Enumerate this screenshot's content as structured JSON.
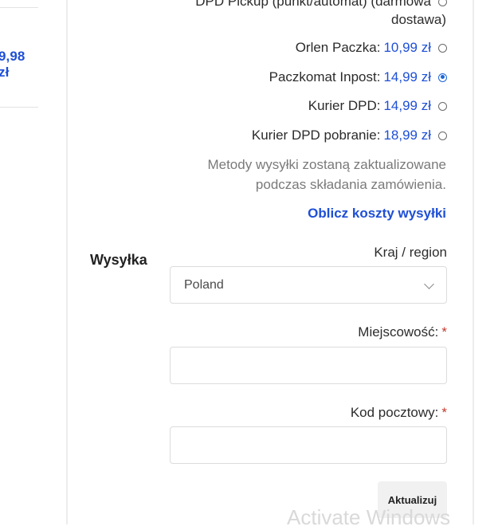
{
  "left": {
    "price": "9,98 zł"
  },
  "shipping": {
    "option_top": {
      "label": "DPD Pickup (punkt/automat) (darmowa",
      "label_cont": "dostawa)"
    },
    "options": [
      {
        "label": "Orlen Paczka:",
        "price": "10,99 zł",
        "checked": false
      },
      {
        "label": "Paczkomat Inpost:",
        "price": "14,99 zł",
        "checked": true
      },
      {
        "label": "Kurier DPD:",
        "price": "14,99 zł",
        "checked": false
      },
      {
        "label": "Kurier DPD pobranie:",
        "price": "18,99 zł",
        "checked": false
      }
    ],
    "note_line1": "Metody wysyłki zostaną zaktualizowane",
    "note_line2": "podczas składania zamówienia.",
    "calc_link": "Oblicz koszty wysyłki"
  },
  "form": {
    "section_label": "Wysyłka",
    "country_label": "Kraj / region",
    "country_value": "Poland",
    "city_label": "Miejscowość:",
    "postcode_label": "Kod pocztowy:",
    "required_mark": "*",
    "update_label": "Aktualizuj"
  },
  "watermark": "Activate Windows"
}
